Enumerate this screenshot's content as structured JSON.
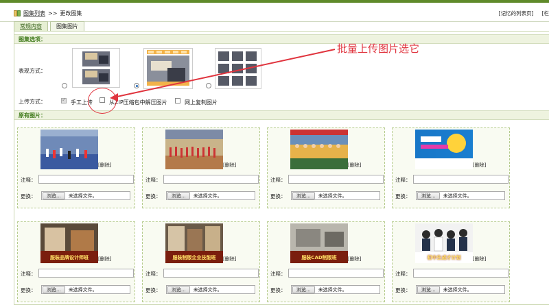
{
  "breadcrumb": {
    "list_link": "图集列表",
    "separator": ">>",
    "current": "更改图集"
  },
  "header_links": {
    "remembered_list": "[记忆的列表页]",
    "column": "[栏"
  },
  "tabs": [
    {
      "label": "常规内容",
      "active": true
    },
    {
      "label": "图集图片",
      "active": false
    }
  ],
  "options_section": {
    "title": "图集选项：",
    "display_label": "表现方式：",
    "display_options": [
      {
        "name": "layout-two-rows",
        "selected": false
      },
      {
        "name": "layout-slide",
        "selected": true
      },
      {
        "name": "layout-grid",
        "selected": false
      }
    ],
    "upload_label": "上传方式：",
    "upload_options": [
      {
        "label": "手工上传",
        "checked": true
      },
      {
        "label": "从ZIP压缩包中解压图片",
        "checked": false
      },
      {
        "label": "网上复制图片",
        "checked": false
      }
    ]
  },
  "annotation": {
    "text": "批量上传图片选它",
    "color": "#e0343e"
  },
  "images_section": {
    "title": "原有图片：",
    "note_label": "注释：",
    "replace_label": "更换：",
    "browse_label": "浏览...",
    "no_file_label": "未选择文件。",
    "delete_label": "[删除]",
    "items": [
      {
        "scene": "sports-hall-event",
        "caption": ""
      },
      {
        "scene": "gym-event",
        "caption": ""
      },
      {
        "scene": "group-photo",
        "caption": ""
      },
      {
        "scene": "promo-banner",
        "caption": ""
      },
      {
        "scene": "classroom-sewing",
        "caption": "服装品牌设计师班"
      },
      {
        "scene": "classroom-pattern",
        "caption": "服装制版企业技能班"
      },
      {
        "scene": "cad-workshop",
        "caption": "服装CAD制版班"
      },
      {
        "scene": "students",
        "caption": "初中生成才计划"
      }
    ]
  },
  "colors": {
    "accent": "#3f7a1a",
    "section_bg": "#eef3df",
    "card_border": "#b6cc8e"
  }
}
